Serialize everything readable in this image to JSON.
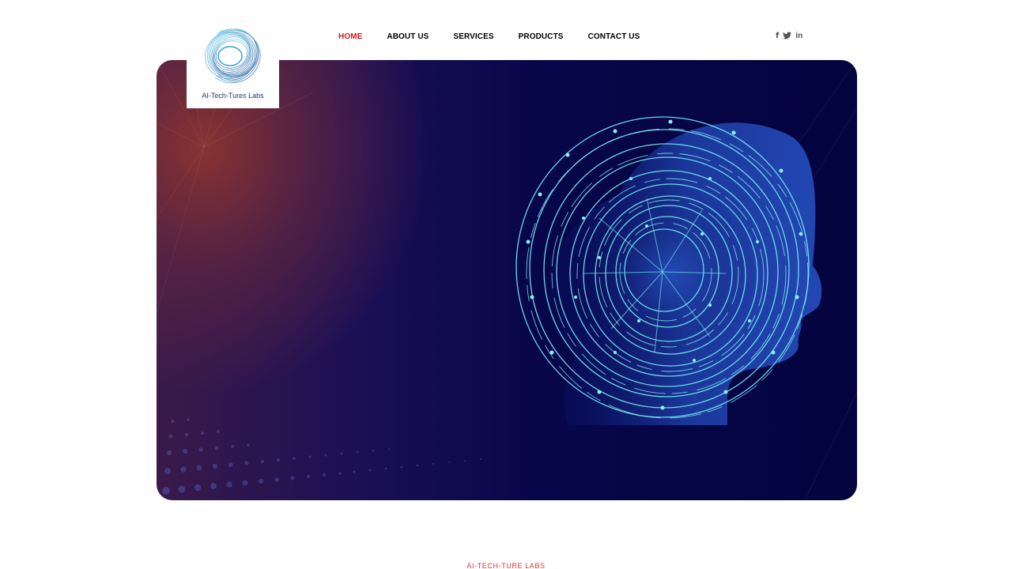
{
  "brand": {
    "logo_text": "AI-Tech-Tures Labs"
  },
  "nav": {
    "items": [
      {
        "label": "HOME",
        "active": true
      },
      {
        "label": "ABOUT US",
        "active": false
      },
      {
        "label": "SERVICES",
        "active": false
      },
      {
        "label": "PRODUCTS",
        "active": false
      },
      {
        "label": "CONTACT US",
        "active": false
      }
    ],
    "active_color": "#d9111d"
  },
  "social": {
    "icons": [
      "facebook-icon",
      "twitter-icon",
      "linkedin-icon"
    ],
    "glyphs": [
      "f",
      "🐦",
      "in"
    ]
  },
  "hero": {
    "image": "ai-head-circuit-illustration",
    "colors": {
      "navy": "#04043f",
      "accent_red": "#8c3430",
      "circuit": "#6fe3f0"
    }
  },
  "footer": {
    "label": "AI-TECH-TURE LABS"
  }
}
